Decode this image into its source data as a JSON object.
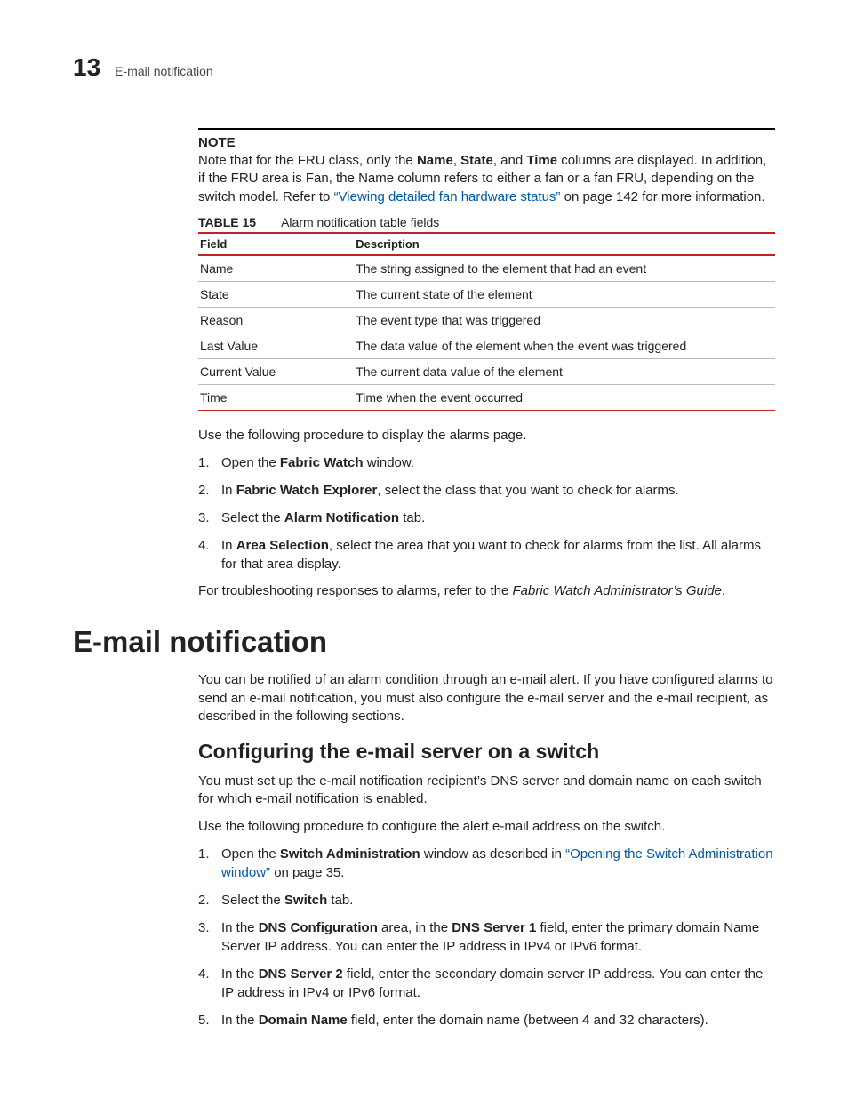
{
  "header": {
    "chapter_number": "13",
    "chapter_title": "E-mail notification"
  },
  "note": {
    "label": "NOTE",
    "text_before": "Note that for the FRU class, only the ",
    "b1": "Name",
    "sep1": ", ",
    "b2": "State",
    "sep2": ", and ",
    "b3": "Time",
    "text_mid": " columns are displayed. In addition, if the FRU area is Fan, the Name column refers to either a fan or a fan FRU, depending on the switch model. Refer to ",
    "link": "“Viewing detailed fan hardware status”",
    "text_after": " on page 142 for more information."
  },
  "table": {
    "caption_label": "TABLE 15",
    "caption_text": "Alarm notification table fields",
    "head_field": "Field",
    "head_desc": "Description",
    "rows": [
      {
        "field": "Name",
        "desc": "The string assigned to the element that had an event"
      },
      {
        "field": "State",
        "desc": "The current state of the element"
      },
      {
        "field": "Reason",
        "desc": "The event type that was triggered"
      },
      {
        "field": "Last Value",
        "desc": "The data value of the element when the event was triggered"
      },
      {
        "field": "Current Value",
        "desc": "The current data value of the element"
      },
      {
        "field": "Time",
        "desc": "Time when the event occurred"
      }
    ]
  },
  "proc_intro": "Use the following procedure to display the alarms page.",
  "proc": {
    "s1a": "Open the ",
    "s1b": "Fabric Watch",
    "s1c": " window.",
    "s2a": "In ",
    "s2b": "Fabric Watch Explorer",
    "s2c": ", select the class that you want to check for alarms.",
    "s3a": "Select the ",
    "s3b": "Alarm Notification",
    "s3c": " tab.",
    "s4a": "In ",
    "s4b": "Area Selection",
    "s4c": ", select the area that you want to check for alarms from the list. All alarms for that area display."
  },
  "troubleshoot_a": "For troubleshooting responses to alarms, refer to the ",
  "troubleshoot_i": "Fabric Watch Administrator’s Guide",
  "troubleshoot_b": ".",
  "h1": "E-mail notification",
  "email_intro": "You can be notified of an alarm condition through an e-mail alert. If you have configured alarms to send an e-mail notification, you must also configure the e-mail server and the e-mail recipient, as described in the following sections.",
  "h2": "Configuring the e-mail server on a switch",
  "email_p1": "You must set up the e-mail notification recipient’s DNS server and domain name on each switch for which e-mail notification is enabled.",
  "email_p2": "Use the following procedure to configure the alert e-mail address on the switch.",
  "proc2": {
    "s1a": "Open the ",
    "s1b": "Switch Administration",
    "s1c": " window as described in ",
    "s1link": "“Opening the Switch Administration window”",
    "s1d": " on page 35.",
    "s2a": "Select the ",
    "s2b": "Switch",
    "s2c": " tab.",
    "s3a": "In the ",
    "s3b": "DNS Configuration",
    "s3c": " area, in the ",
    "s3d": "DNS Server 1",
    "s3e": " field, enter the primary domain Name Server IP address. You can enter the IP address in IPv4 or IPv6 format.",
    "s4a": "In the ",
    "s4b": "DNS Server 2",
    "s4c": " field, enter the secondary domain server IP address. You can enter the IP address in IPv4 or IPv6 format.",
    "s5a": "In the ",
    "s5b": "Domain Name",
    "s5c": " field, enter the domain name (between 4 and 32 characters)."
  },
  "nums": {
    "n1": "1.",
    "n2": "2.",
    "n3": "3.",
    "n4": "4.",
    "n5": "5."
  }
}
